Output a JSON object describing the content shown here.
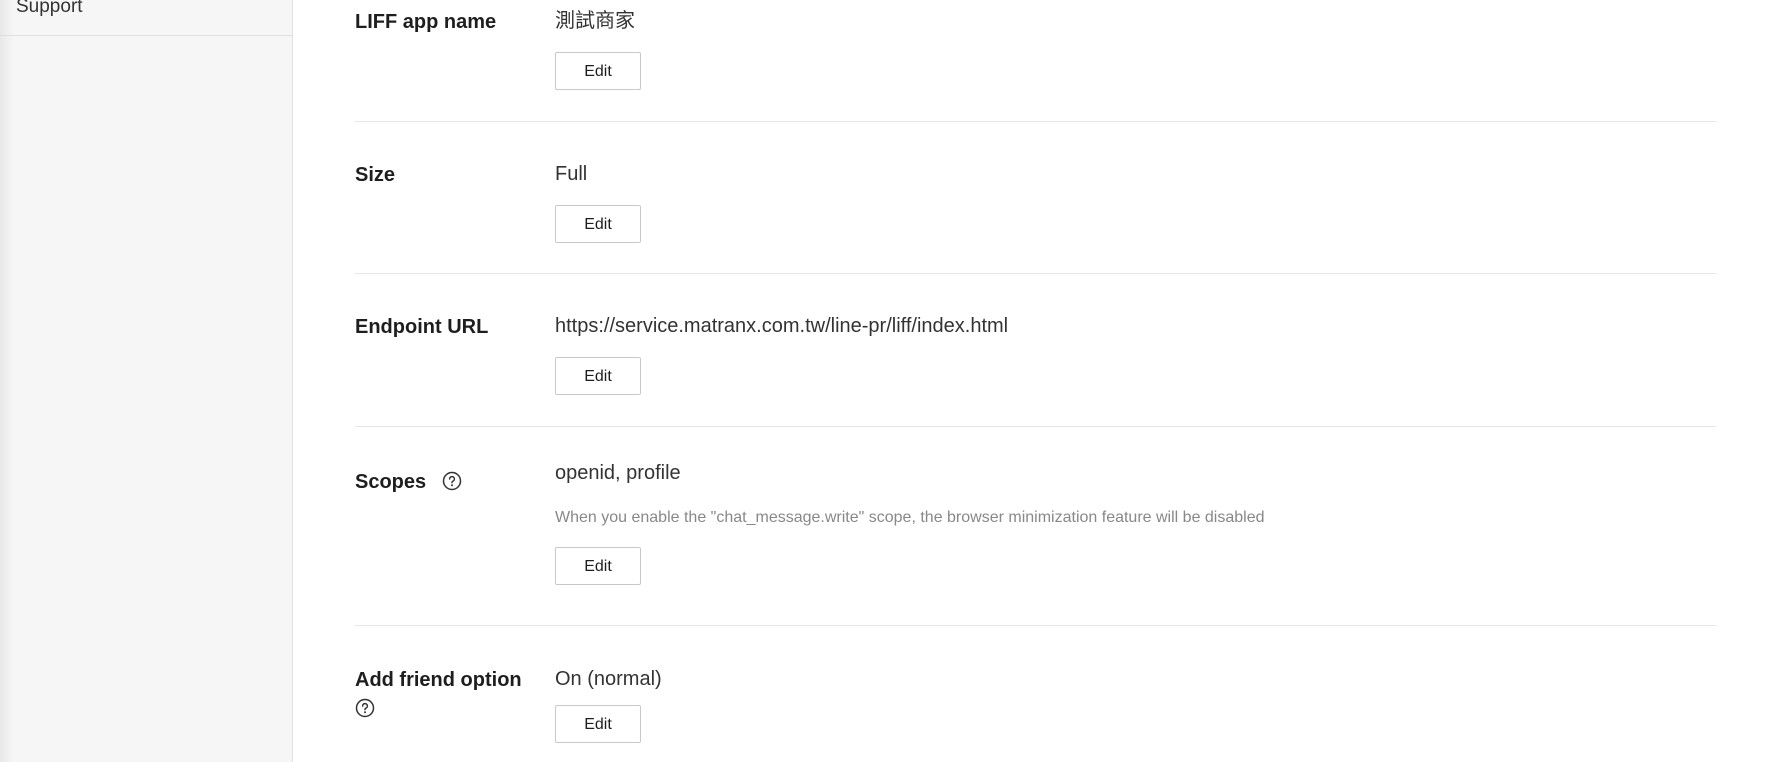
{
  "sidebar": {
    "items": [
      {
        "label": "Support"
      }
    ]
  },
  "rows": {
    "app_name": {
      "label": "LIFF app name",
      "value": "測試商家",
      "button": "Edit"
    },
    "size": {
      "label": "Size",
      "value": "Full",
      "button": "Edit"
    },
    "endpoint": {
      "label": "Endpoint URL",
      "value": "https://service.matranx.com.tw/line-pr/liff/index.html",
      "button": "Edit"
    },
    "scopes": {
      "label": "Scopes",
      "value": "openid, profile",
      "note": "When you enable the \"chat_message.write\" scope, the browser minimization feature will be disabled",
      "button": "Edit",
      "help_icon": "question-circle-icon"
    },
    "add_friend": {
      "label": "Add friend option",
      "value": "On (normal)",
      "button": "Edit",
      "help_icon": "question-circle-icon"
    }
  }
}
